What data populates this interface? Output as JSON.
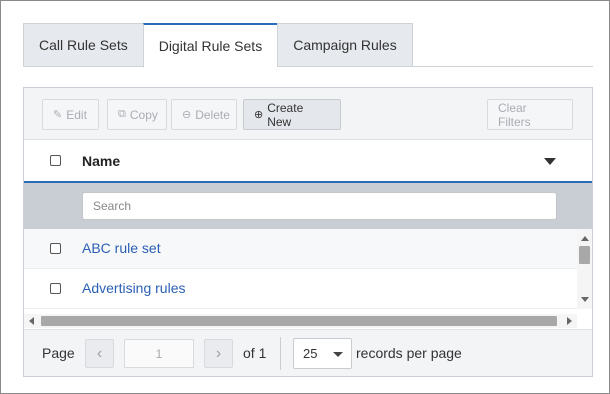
{
  "tabs": [
    {
      "label": "Call Rule Sets",
      "active": false
    },
    {
      "label": "Digital Rule Sets",
      "active": true
    },
    {
      "label": "Campaign Rules",
      "active": false
    }
  ],
  "toolbar": {
    "edit_label": "Edit",
    "copy_label": "Copy",
    "delete_label": "Delete",
    "create_label": "Create New",
    "clear_label": "Clear Filters"
  },
  "grid": {
    "column_name": "Name",
    "search_placeholder": "Search",
    "rows": [
      {
        "name": "ABC rule set"
      },
      {
        "name": "Advertising rules"
      }
    ]
  },
  "pager": {
    "page_label": "Page",
    "current_page": "1",
    "of_label": "of 1",
    "page_size": "25",
    "records_label": "records per page"
  },
  "colors": {
    "accent": "#2b6cb8",
    "link": "#2b5fb4"
  }
}
